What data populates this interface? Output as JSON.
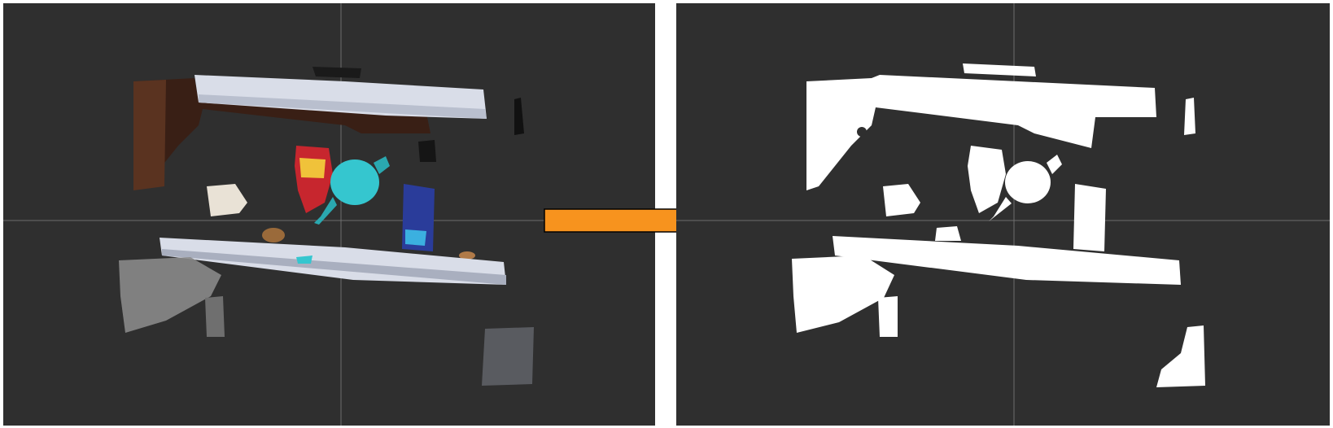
{
  "panels": {
    "left": {
      "view": "point-cloud-color",
      "background": "#2f2f2f",
      "crosshair": true
    },
    "right": {
      "view": "binary-mask",
      "background": "#2f2f2f",
      "foreground": "#ffffff",
      "crosshair": true
    }
  },
  "arrow": {
    "direction": "right",
    "fill": "#f7931e",
    "stroke": "#000000"
  },
  "colors": {
    "shelf": "#d9dde8",
    "wood": "#3a1f14",
    "cup": "#35c6cf",
    "chips_bag": "#c7262e",
    "blue_box": "#2a3c9a",
    "wall_gray": "#8a8a8a",
    "mask_white": "#ffffff"
  }
}
